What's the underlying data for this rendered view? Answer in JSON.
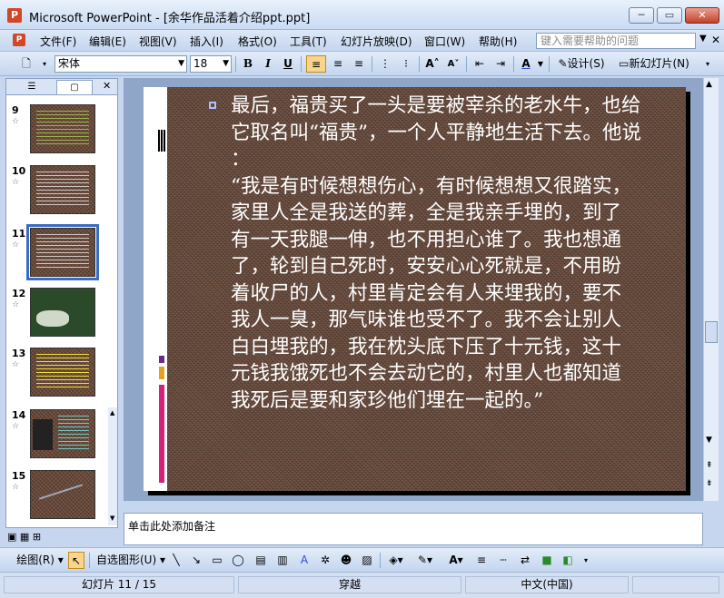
{
  "window": {
    "app_icon": "P",
    "title": "Microsoft PowerPoint - [余华作品活着介绍ppt.ppt]",
    "minimize": "─",
    "restore": "▭",
    "close": "✕"
  },
  "menu": {
    "items": [
      "文件(F)",
      "编辑(E)",
      "视图(V)",
      "插入(I)",
      "格式(O)",
      "工具(T)",
      "幻灯片放映(D)",
      "窗口(W)",
      "帮助(H)"
    ],
    "help_placeholder": "键入需要帮助的问题"
  },
  "toolbar": {
    "font_name": "宋体",
    "font_size": "18",
    "bold": "B",
    "italic": "I",
    "underline": "U",
    "design": "设计(S)",
    "new_slide": "新幻灯片(N)"
  },
  "slides_panel": {
    "tabs": [
      "☰",
      "▢"
    ],
    "close": "✕",
    "slides": [
      {
        "num": "9"
      },
      {
        "num": "10"
      },
      {
        "num": "11",
        "selected": true
      },
      {
        "num": "12"
      },
      {
        "num": "13"
      },
      {
        "num": "14"
      },
      {
        "num": "15"
      }
    ]
  },
  "slide_content": {
    "lines": [
      "最后，福贵买了一头是要被宰杀的老水牛，也给",
      "它取名叫“福贵”，一个人平静地生活下去。他说",
      "：",
      "“我是有时候想想伤心，有时候想想又很踏实，",
      "家里人全是我送的葬，全是我亲手埋的，到了",
      "有一天我腿一伸，也不用担心谁了。我也想通",
      "了，轮到自己死时，安安心心死就是，不用盼",
      "着收尸的人，村里肯定会有人来埋我的，要不",
      "我人一臭，那气味谁也受不了。我不会让别人",
      "白白埋我的，我在枕头底下压了十元钱，这十",
      "元钱我饿死也不会去动它的，村里人也都知道",
      "我死后是要和家珍他们埋在一起的。”"
    ]
  },
  "notes": {
    "placeholder": "单击此处添加备注"
  },
  "drawbar": {
    "draw": "绘图(R)",
    "autoshapes": "自选图形(U)"
  },
  "status": {
    "slide_info": "幻灯片 11 / 15",
    "design": "穿越",
    "language": "中文(中国)"
  },
  "colors": {
    "accent_selected": "#3a6cc0",
    "slide_bg": "#6d4f40",
    "deco_purple": "#6a2c8c",
    "deco_orange": "#e8a020",
    "deco_pink": "#d8207a"
  }
}
